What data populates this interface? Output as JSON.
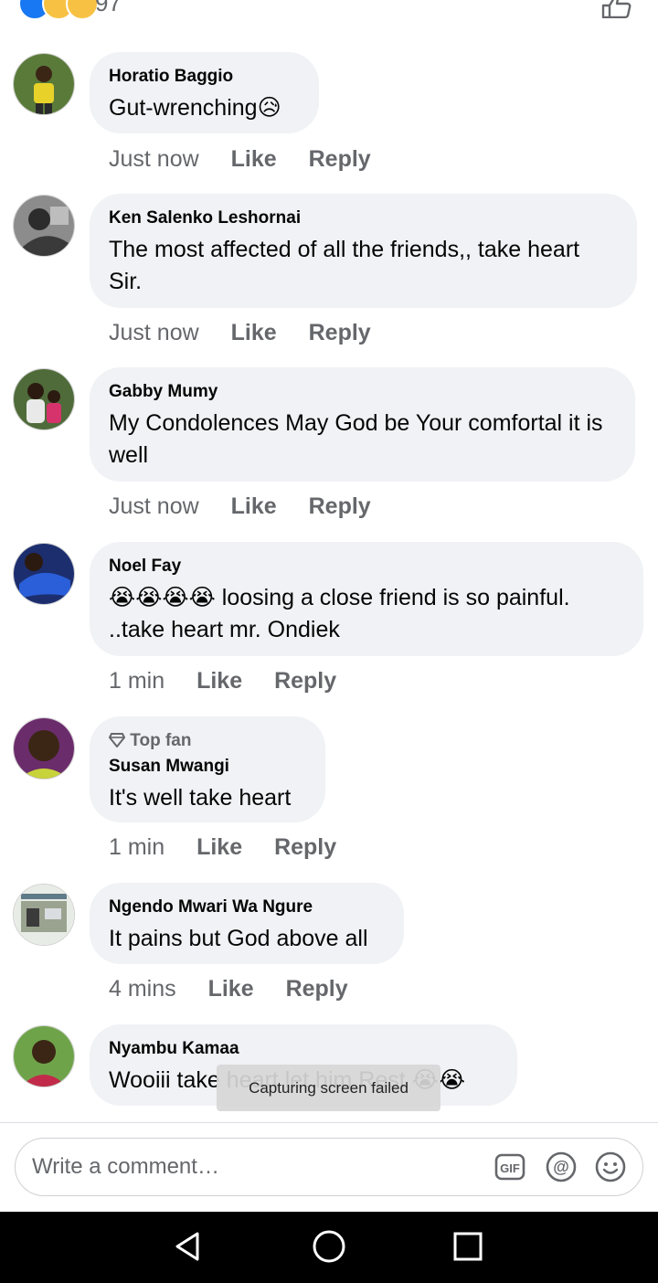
{
  "reactions": {
    "count": "97"
  },
  "comments": [
    {
      "name": "Horatio Baggio",
      "text": "Gut-wrenching😥",
      "time": "Just now"
    },
    {
      "name": "Ken Salenko Leshornai",
      "text": "The most affected of all the friends,, take heart Sir.",
      "time": "Just now"
    },
    {
      "name": "Gabby Mumy",
      "text": "My Condolences May God be Your comfortal it is well",
      "time": "Just now"
    },
    {
      "name": "Noel Fay",
      "text": "😭😭😭😭 loosing a close friend is so painful. ..take heart mr. Ondiek",
      "time": "1 min"
    },
    {
      "badge": "Top fan",
      "name": "Susan Mwangi",
      "text": "It's well take heart",
      "time": "1 min"
    },
    {
      "name": "Ngendo Mwari Wa Ngure",
      "text": "It pains but God above all",
      "time": "4 mins"
    },
    {
      "name": "Nyambu Kamaa",
      "text": "Wooiii take heart let him Rest 😭😭",
      "time": ""
    }
  ],
  "actions": {
    "like": "Like",
    "reply": "Reply"
  },
  "toast": "Capturing screen failed",
  "composer": {
    "placeholder": "Write a comment…"
  },
  "icons": {
    "like": "like-reaction-icon",
    "sad": "sad-reaction-icon",
    "thumb": "thumbs-up-icon",
    "gif": "gif-icon",
    "mention": "mention-icon",
    "emoji": "emoji-icon",
    "diamond": "diamond-icon",
    "back": "back-icon",
    "home": "home-icon",
    "recents": "recents-icon"
  },
  "colors": {
    "accent": "#1877f2",
    "bubble": "#f0f2f5",
    "secondary_text": "#65676b"
  }
}
